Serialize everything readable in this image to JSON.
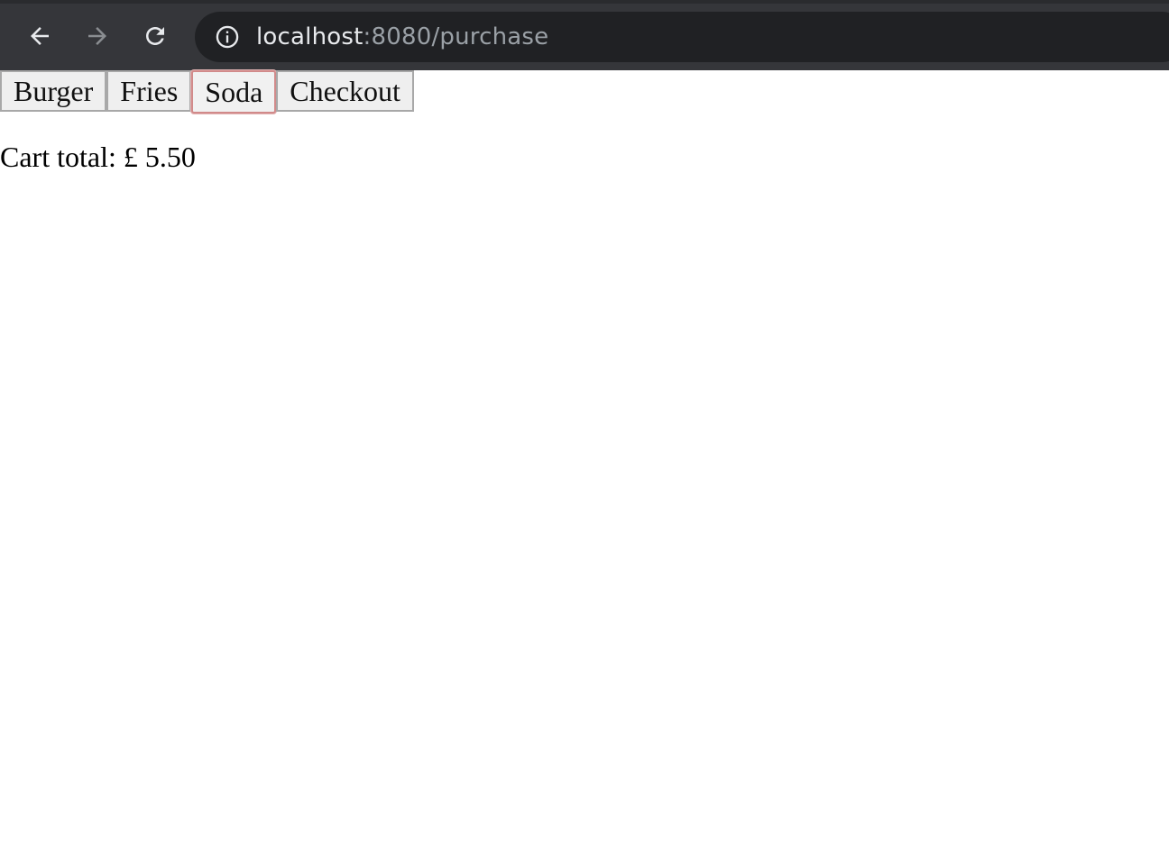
{
  "browser": {
    "url_host": "localhost",
    "url_rest": ":8080/purchase",
    "icons": {
      "back": "back-arrow-icon",
      "forward": "forward-arrow-icon",
      "reload": "reload-icon",
      "site_info": "info-icon"
    }
  },
  "page": {
    "buttons": [
      {
        "label": "Burger"
      },
      {
        "label": "Fries"
      },
      {
        "label": "Soda"
      },
      {
        "label": "Checkout"
      }
    ],
    "focused_button": "Soda",
    "cart_total_label": "Cart total: £ 5.50"
  },
  "colors": {
    "toolbar_bg": "#35363a",
    "omnibox_bg": "#202124",
    "focus_ring": "#d18a8a"
  }
}
